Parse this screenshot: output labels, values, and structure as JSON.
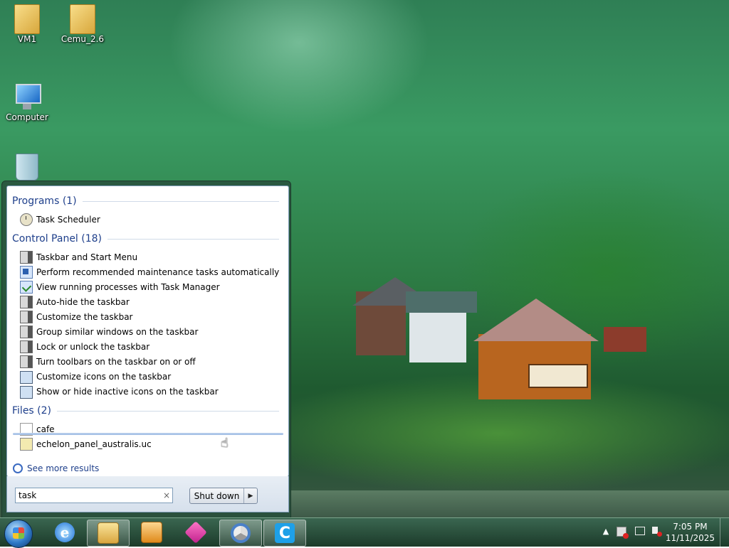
{
  "desktop": {
    "icons": [
      {
        "label": "VM1",
        "icon": "folder-icon"
      },
      {
        "label": "Cemu_2.6",
        "icon": "folder-icon"
      },
      {
        "label": "Computer",
        "icon": "computer-icon"
      },
      {
        "label": "",
        "icon": "recycle-bin-icon"
      }
    ]
  },
  "start_menu": {
    "groups": {
      "programs": {
        "header": "Programs (1)",
        "items": [
          "Task Scheduler"
        ]
      },
      "control_panel": {
        "header": "Control Panel (18)",
        "items": [
          "Taskbar and Start Menu",
          "Perform recommended maintenance tasks automatically",
          "View running processes with Task Manager",
          "Auto-hide the taskbar",
          "Customize the taskbar",
          "Group similar windows on the taskbar",
          "Lock or unlock the taskbar",
          "Turn toolbars on the taskbar on or off",
          "Customize icons on the taskbar",
          "Show or hide inactive icons on the taskbar"
        ]
      },
      "files": {
        "header": "Files (2)",
        "items": [
          "cafe",
          "echelon_panel_australis.uc"
        ]
      }
    },
    "see_more": "See more results",
    "search": {
      "value": "task",
      "clear": "×"
    },
    "shutdown": {
      "label": "Shut down",
      "arrow": "▶"
    }
  },
  "taskbar": {
    "clock": {
      "time": "7:05 PM",
      "date": "11/11/2025"
    },
    "tray_expand": "▲",
    "buttons": [
      {
        "icon": "internet-explorer-icon"
      },
      {
        "icon": "file-explorer-icon"
      },
      {
        "icon": "media-player-icon"
      },
      {
        "icon": "app-pink-icon"
      },
      {
        "icon": "app-chrome-icon"
      },
      {
        "icon": "app-c-icon",
        "glyph": "C"
      }
    ]
  }
}
